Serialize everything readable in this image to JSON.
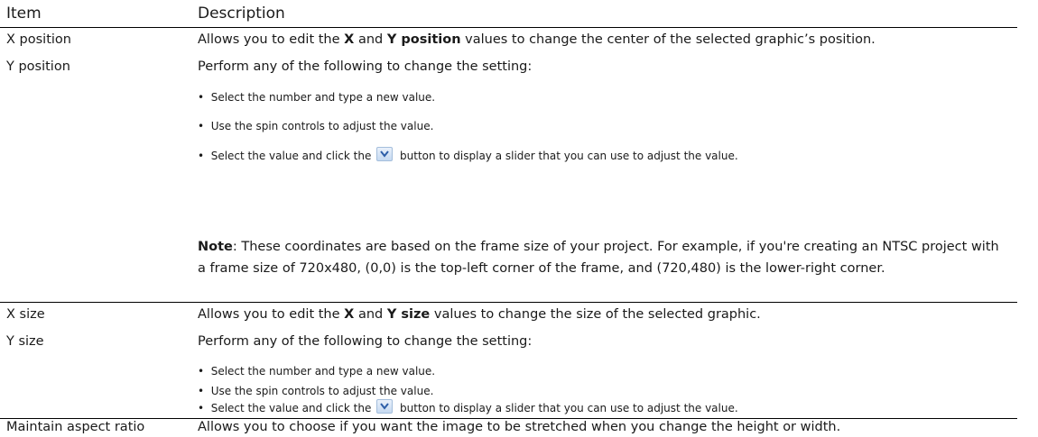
{
  "header": {
    "item": "Item",
    "description": "Description"
  },
  "rows": {
    "xpos": {
      "item": "X position",
      "desc_pre": "Allows you to edit the ",
      "desc_b1": "X",
      "desc_mid": " and ",
      "desc_b2": "Y position",
      "desc_post": " values to change the center of the selected graphic’s position."
    },
    "ypos": {
      "item": "Y position",
      "desc": "Perform any of the following to change the setting:",
      "bullets": [
        "Select the number and type a new value.",
        "Use the spin controls to adjust the value.",
        "Select the value and click the",
        "button to display a slider that you can use to adjust the value."
      ],
      "note_label": "Note",
      "note_text": ": These coordinates are based on the frame size of your project. For example, if you're creating an NTSC project with a frame size of 720x480, (0,0) is the top-left corner of the frame, and (720,480) is the lower-right corner."
    },
    "xsize": {
      "item": "X size",
      "desc_pre": "Allows you to edit the ",
      "desc_b1": "X",
      "desc_mid": " and ",
      "desc_b2": "Y size",
      "desc_post": " values to change the size of the selected graphic."
    },
    "ysize": {
      "item": "Y size",
      "desc": "Perform any of the following to change the setting:",
      "bullets": [
        "Select the number and type a new value.",
        "Use the spin controls to adjust the value.",
        "Select the value and click the",
        "button to display a slider that you can use to adjust the value."
      ]
    },
    "aspect": {
      "item": "Maintain aspect ratio",
      "desc": "Allows you to choose if you want the image to be stretched when you change the height or width."
    }
  },
  "icons": {
    "dropdown": "chevron-down-icon"
  }
}
